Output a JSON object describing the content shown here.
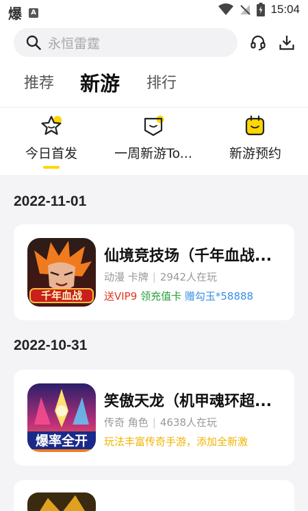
{
  "status_bar": {
    "time": "15:04",
    "left_glyph": "爆",
    "left_badge": "A"
  },
  "search": {
    "placeholder": "永恒雷霆"
  },
  "tabs": [
    {
      "label": "推荐",
      "active": false
    },
    {
      "label": "新游",
      "active": true
    },
    {
      "label": "排行",
      "active": false
    }
  ],
  "subtabs": [
    {
      "label": "今日首发",
      "active": true
    },
    {
      "label": "一周新游To...",
      "active": false
    },
    {
      "label": "新游预约",
      "active": false
    }
  ],
  "sections": [
    {
      "date": "2022-11-01",
      "game": {
        "title": "仙境竞技场（千年血战...",
        "genre": "动漫 卡牌",
        "players": "2942人在玩",
        "cover_text": "千年血战",
        "tags": [
          {
            "text": "送VIP9",
            "color": "red"
          },
          {
            "text": "领充值卡",
            "color": "green"
          },
          {
            "text": "赠勾玉*58888",
            "color": "blue"
          }
        ]
      }
    },
    {
      "date": "2022-10-31",
      "game": {
        "title": "笑傲天龙（机甲魂环超...",
        "genre": "传奇 角色",
        "players": "4638人在玩",
        "cover_text": "爆率全开",
        "tags": [
          {
            "text": "玩法丰富传奇手游，添加全新激",
            "color": "yellow"
          }
        ]
      }
    }
  ],
  "colors": {
    "accent": "#ffd600",
    "background": "#f4f4f6",
    "card": "#ffffff"
  }
}
